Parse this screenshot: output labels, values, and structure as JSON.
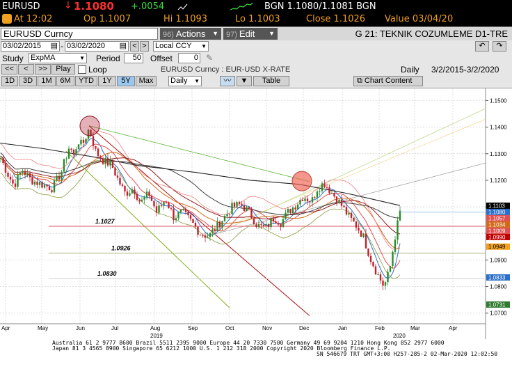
{
  "quote": {
    "ticker": "EURUSD",
    "last": "1.1080",
    "change": "+.0054",
    "time": "At 12:02",
    "open": "Op 1.1007",
    "high": "Hi 1.1093",
    "low": "Lo 1.1003",
    "bid_ask": "BGN  1.1080/1.1081  BGN",
    "close": "Close 1.1026",
    "value": "Value 03/04/20"
  },
  "titlebar": {
    "security": "EURUSD  Curncy",
    "actions_num": "96)",
    "actions_label": "Actions",
    "edit_num": "97)",
    "edit_label": "Edit",
    "title": "G 21: TEKNIK COZUMLEME D1-TRE"
  },
  "controls": {
    "start_date": "03/02/2015",
    "end_date": "03/02/2020",
    "currency": "Local CCY",
    "study_label": "Study",
    "study_value": "ExpMA",
    "period_label": "Period",
    "period_value": "50",
    "offset_label": "Offset",
    "offset_value": "0",
    "play_label": "Play",
    "loop_label": "Loop",
    "security_desc": "EURUSD  Curncy : EUR-USD X-RATE",
    "frequency": "Daily",
    "range_text": "3/2/2015-3/2/2020",
    "periods": [
      "1D",
      "3D",
      "1M",
      "6M",
      "YTD",
      "1Y",
      "5Y",
      "Max"
    ],
    "selected_period": "5Y",
    "freq_select": "Daily",
    "table_label": "Table",
    "chart_content_label": "Chart Content"
  },
  "chart_data": {
    "type": "line",
    "x_tick_labels": [
      "Apr",
      "May",
      "Jun",
      "Jul",
      "Aug",
      "Sep",
      "Oct",
      "Nov",
      "Dec",
      "Jan",
      "Feb",
      "Mar",
      "Apr"
    ],
    "year_labels": [
      "2019",
      "2020"
    ],
    "y_tick_labels": [
      "1.1500",
      "1.1400",
      "1.1300",
      "1.1200",
      "1.1100",
      "1.1000",
      "1.0900",
      "1.0800",
      "1.0700"
    ],
    "ylim": [
      1.066,
      1.153
    ],
    "annotation_labels": [
      "1.1027",
      "1.0926",
      "1.0830"
    ],
    "right_tags": [
      {
        "label": "1.1103",
        "bg": "#000000",
        "fg": "#ffffff"
      },
      {
        "label": "1.1080",
        "bg": "#2b6fc9",
        "fg": "#ffffff"
      },
      {
        "label": "1.1057",
        "bg": "#e05050",
        "fg": "#ffffff"
      },
      {
        "label": "1.1034",
        "bg": "#d06a1a",
        "fg": "#ffffff"
      },
      {
        "label": "1.1009",
        "bg": "#e05050",
        "fg": "#ffffff"
      },
      {
        "label": "1.0990",
        "bg": "#c00000",
        "fg": "#ffffff"
      },
      {
        "label": "1.0949",
        "bg": "#f2a020",
        "fg": "#000000"
      },
      {
        "label": "1.0833",
        "bg": "#2b6fc9",
        "fg": "#ffffff"
      },
      {
        "label": "1.0731",
        "bg": "#2f7a2f",
        "fg": "#ffffff"
      }
    ],
    "grid": true
  },
  "footer": {
    "line1": "Australia 61 2 9777 8600 Brazil 5511 2395 9000 Europe 44 20 7330 7500 Germany 49 69 9204 1210 Hong Kong 852 2977 6000",
    "line2": "Japan 81 3 4565 8900        Singapore 65 6212 1000        U.S. 1 212 318 2000          Copyright 2020 Bloomberg Finance L.P.",
    "line3": "SN 546679 TRT  GMT+3:00 H257-285-2 02-Mar-2020 12:02:50"
  },
  "colors": {
    "up": "#2a8a2a",
    "down": "#c0202e",
    "highlight": "#b02030"
  }
}
